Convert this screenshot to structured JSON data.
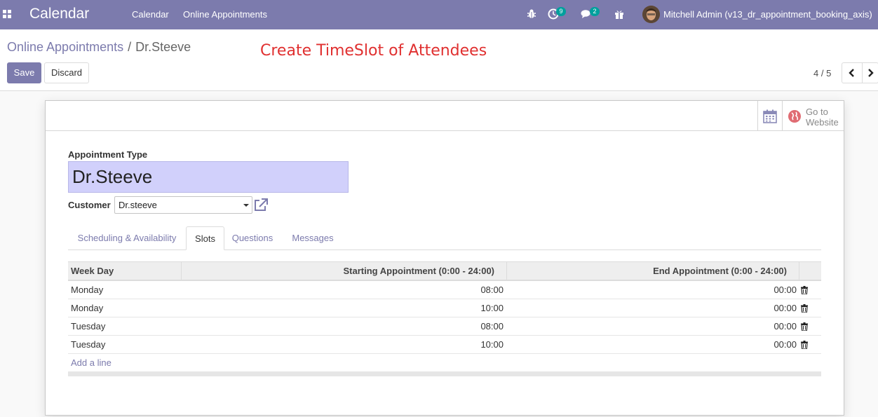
{
  "navbar": {
    "app_title": "Calendar",
    "menu": [
      "Calendar",
      "Online Appointments"
    ],
    "activity_count": "9",
    "message_count": "2",
    "user_name": "Mitchell Admin (v13_dr_appointment_booking_axis)"
  },
  "breadcrumb": {
    "parent": "Online Appointments",
    "separator": "/",
    "current": "Dr.Steeve"
  },
  "annotation": "Create TimeSlot of Attendees",
  "buttons": {
    "save": "Save",
    "discard": "Discard"
  },
  "pager": {
    "value": "4 / 5"
  },
  "smart_buttons": {
    "website_line1": "Go to",
    "website_line2": "Website"
  },
  "form": {
    "name_label": "Appointment Type",
    "name_value": "Dr.Steeve",
    "customer_label": "Customer",
    "customer_value": "Dr.steeve"
  },
  "tabs": [
    "Scheduling & Availability",
    "Slots",
    "Questions",
    "Messages"
  ],
  "active_tab": "Slots",
  "slots_table": {
    "columns": [
      "Week Day",
      "Starting Appointment (0:00 - 24:00)",
      "End Appointment (0:00 - 24:00)"
    ],
    "rows": [
      {
        "day": "Monday",
        "start": "08:00",
        "end": "00:00"
      },
      {
        "day": "Monday",
        "start": "10:00",
        "end": "00:00"
      },
      {
        "day": "Tuesday",
        "start": "08:00",
        "end": "00:00"
      },
      {
        "day": "Tuesday",
        "start": "10:00",
        "end": "00:00"
      }
    ],
    "add_line": "Add a line"
  },
  "colors": {
    "primary": "#7c7bad",
    "badge": "#00a09d",
    "annotation": "#e03030",
    "required_field": "#d1d0fb"
  },
  "icons": [
    "apps-icon",
    "bug-icon",
    "clock-icon",
    "comments-icon",
    "gift-icon",
    "chevron-left-icon",
    "chevron-right-icon",
    "calendar-icon",
    "globe-icon",
    "external-link-icon",
    "trash-icon"
  ]
}
